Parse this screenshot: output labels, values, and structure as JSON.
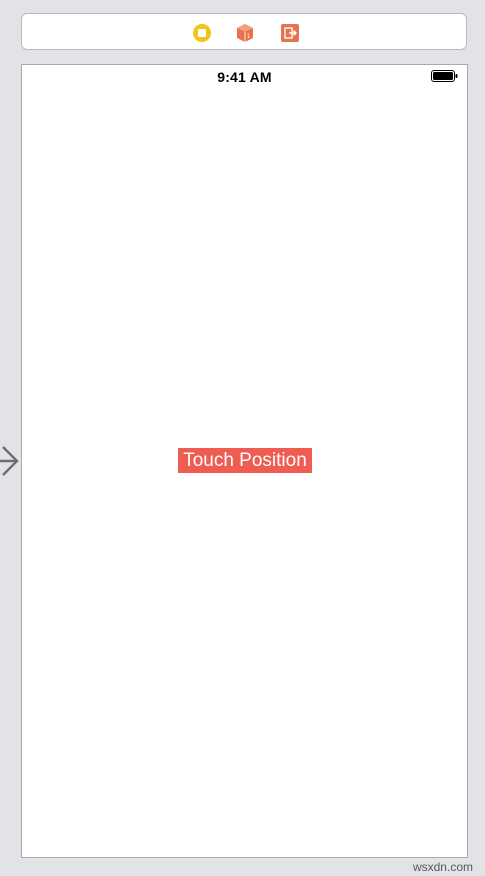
{
  "scene_dock": {
    "icons": [
      "view-controller-icon",
      "first-responder-icon",
      "exit-icon"
    ]
  },
  "status_bar": {
    "time": "9:41 AM"
  },
  "main": {
    "touch_label": "Touch Position"
  },
  "colors": {
    "canvas_background": "#e2e3e6",
    "label_background": "#ee5c52",
    "view_controller_icon": "#f0c419",
    "first_responder_icon": "#e8734a",
    "exit_icon": "#e8734a"
  },
  "watermark": "wsxdn.com"
}
